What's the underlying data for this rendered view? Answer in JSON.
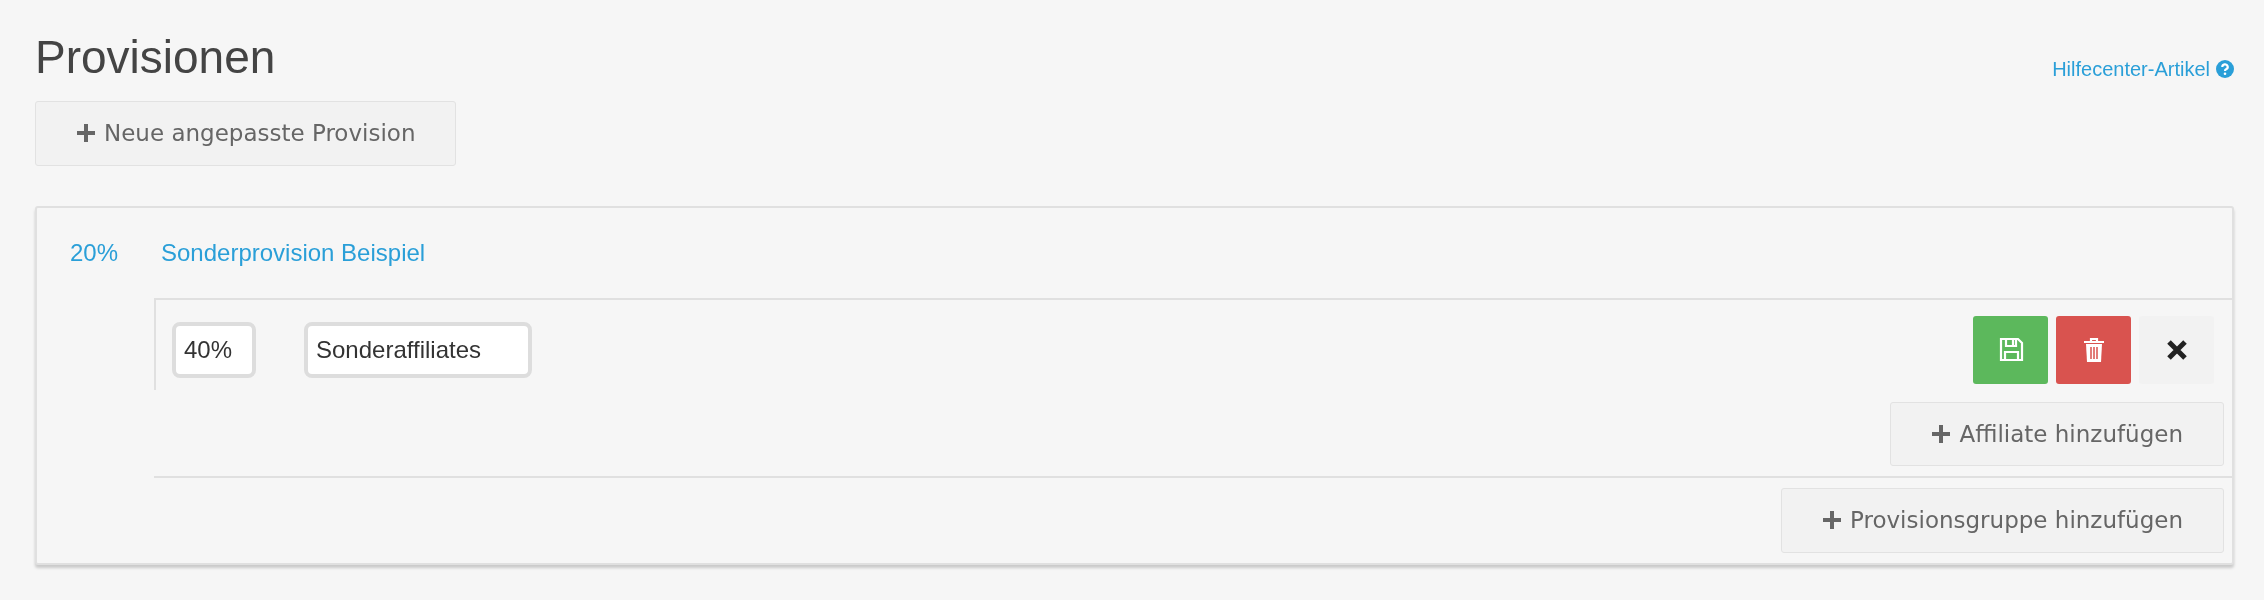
{
  "title": "Provisionen",
  "help_link": {
    "label": "Hilfecenter-Artikel"
  },
  "new_button": {
    "label": "Neue angepasste Provision"
  },
  "commissions": [
    {
      "rate": "20%",
      "name": "Sonderprovision Beispiel",
      "groups": [
        {
          "rate_value": "40%",
          "name_value": "Sonderaffiliates",
          "add_affiliate_label": "Affiliate hinzufügen"
        }
      ],
      "add_group_label": "Provisionsgruppe hinzufügen"
    }
  ]
}
